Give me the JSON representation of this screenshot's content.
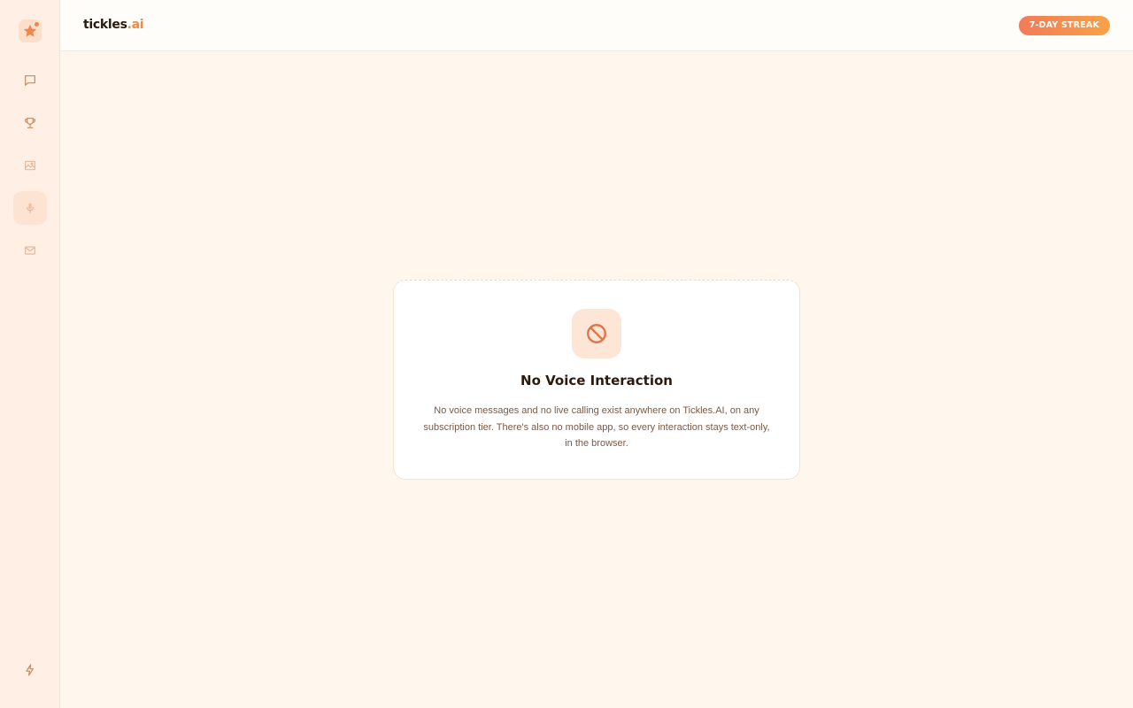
{
  "header": {
    "brand_main": "tickles",
    "brand_accent": ".ai",
    "streak_badge": "7-DAY STREAK"
  },
  "sidebar": {
    "items": [
      {
        "icon": "chat-icon",
        "active": false
      },
      {
        "icon": "trophy-icon",
        "active": false
      },
      {
        "icon": "image-icon",
        "active": false
      },
      {
        "icon": "microphone-icon",
        "active": true
      },
      {
        "icon": "mail-icon",
        "active": false
      }
    ],
    "bottom_icon": "lightning-icon"
  },
  "notice": {
    "icon": "no-entry-icon",
    "title": "No Voice Interaction",
    "description_line1": "No voice messages and no live calling exist anywhere on Tickles.AI, on any",
    "description_line2": "subscription tier. There's also no mobile app, so every interaction stays text-only,",
    "description_line3": "in the browser."
  },
  "colors": {
    "accent": "#f08a45",
    "background": "#fff6ee",
    "sidebar": "#ffefe4"
  }
}
